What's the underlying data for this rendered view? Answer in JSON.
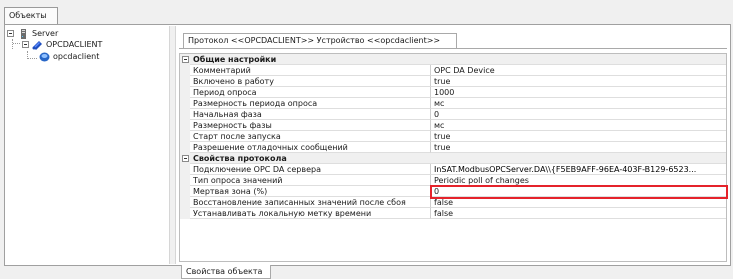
{
  "top_tabs": {
    "objects_label": "Объекты"
  },
  "tree": {
    "root": {
      "label": "Server",
      "icon": "server-icon"
    },
    "client": {
      "label": "OPCDACLIENT",
      "icon": "opc-client-icon"
    },
    "device": {
      "label": "opcdaclient",
      "icon": "device-icon"
    }
  },
  "document": {
    "tab_label": "Протокол <<OPCDACLIENT>> Устройство <<opcdaclient>>"
  },
  "properties": {
    "general": {
      "title": "Общие настройки",
      "rows": [
        {
          "name": "Комментарий",
          "value": "OPC DA Device"
        },
        {
          "name": "Включено в работу",
          "value": "true"
        },
        {
          "name": "Период опроса",
          "value": "1000"
        },
        {
          "name": "Размерность периода опроса",
          "value": "мс"
        },
        {
          "name": "Начальная фаза",
          "value": "0"
        },
        {
          "name": "Размерность фазы",
          "value": "мс"
        },
        {
          "name": "Старт после запуска",
          "value": "true"
        },
        {
          "name": "Разрешение отладочных сообщений",
          "value": "true"
        }
      ]
    },
    "protocol": {
      "title": "Свойства протокола",
      "rows": [
        {
          "name": "Подключение OPC DA сервера",
          "value": "InSAT.ModbusOPCServer.DA\\\\{F5EB9AFF-96EA-403F-B129-6523..."
        },
        {
          "name": "Тип опроса значений",
          "value": "Periodic poll of changes"
        },
        {
          "name": "Мертвая зона (%)",
          "value": "0"
        },
        {
          "name": "Восстановление записанных значений после сбоя",
          "value": "false"
        },
        {
          "name": "Устанавливать локальную метку времени",
          "value": "false"
        }
      ]
    }
  },
  "bottom_tabs": {
    "object_properties_label": "Свойства объекта"
  },
  "colors": {
    "highlight": "#e5232b",
    "category_bg": "#f0f0f0"
  }
}
